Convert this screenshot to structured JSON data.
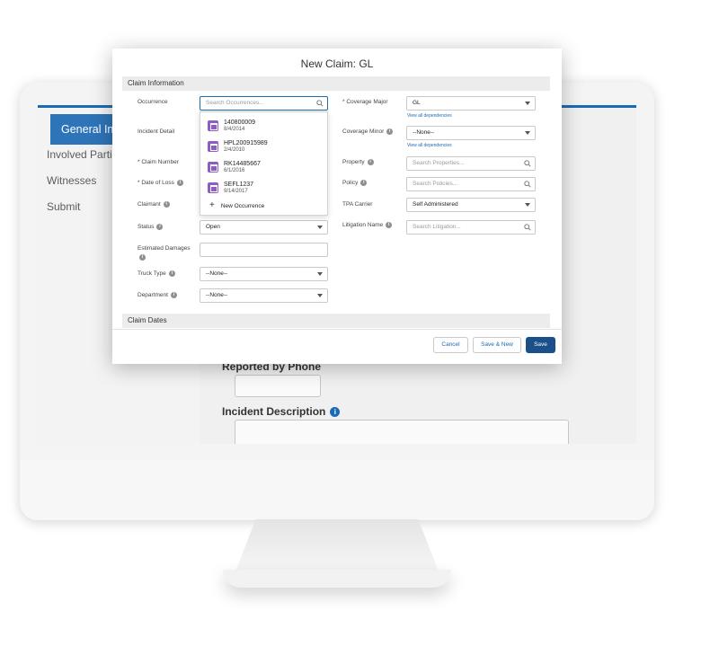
{
  "background_screen": {
    "nav": {
      "active_item": "General Incid",
      "items": [
        "Involved Parties",
        "Witnesses",
        "Submit"
      ]
    },
    "reported_label": "Reported by Phone",
    "incident_description_label": "Incident Description"
  },
  "modal": {
    "title": "New Claim: GL",
    "sections": {
      "claim_information": "Claim Information",
      "claim_dates": "Claim Dates"
    },
    "left_fields": {
      "occurrence_label": "Occurrence",
      "occurrence_placeholder": "Search Occurrences...",
      "incident_detail_label": "Incident Detail",
      "claim_number_label": "* Claim Number",
      "date_of_loss_label": "* Date of Loss",
      "claimant_label": "Claimant",
      "status_label": "Status",
      "status_value": "Open",
      "estimated_damages_label": "Estimated Damages",
      "truck_type_label": "Truck Type",
      "truck_type_value": "--None--",
      "department_label": "Department",
      "department_value": "--None--"
    },
    "right_fields": {
      "coverage_major_label": "* Coverage Major",
      "coverage_major_value": "GL",
      "coverage_minor_label": "Coverage Minor",
      "coverage_minor_value": "--None--",
      "view_dependencies": "View all dependencies",
      "property_label": "Property",
      "property_placeholder": "Search Properties...",
      "policy_label": "Policy",
      "policy_placeholder": "Search Policies...",
      "tpa_carrier_label": "TPA Carrier",
      "tpa_carrier_value": "Self Administered",
      "litigation_name_label": "Litigation Name",
      "litigation_placeholder": "Search Litigation..."
    },
    "occurrence_dropdown": {
      "items": [
        {
          "id": "140800009",
          "date": "8/4/2014"
        },
        {
          "id": "HPL200915989",
          "date": "2/4/2010"
        },
        {
          "id": "RK14485667",
          "date": "6/1/2016"
        },
        {
          "id": "SEFL1237",
          "date": "9/14/2017"
        }
      ],
      "new_label": "New Occurrence"
    },
    "buttons": {
      "cancel": "Cancel",
      "save_new": "Save & New",
      "save": "Save"
    }
  },
  "colors": {
    "brand_blue": "#1b6bb4",
    "primary_button": "#1b4f8a",
    "occurrence_icon": "#8c5cc9"
  }
}
